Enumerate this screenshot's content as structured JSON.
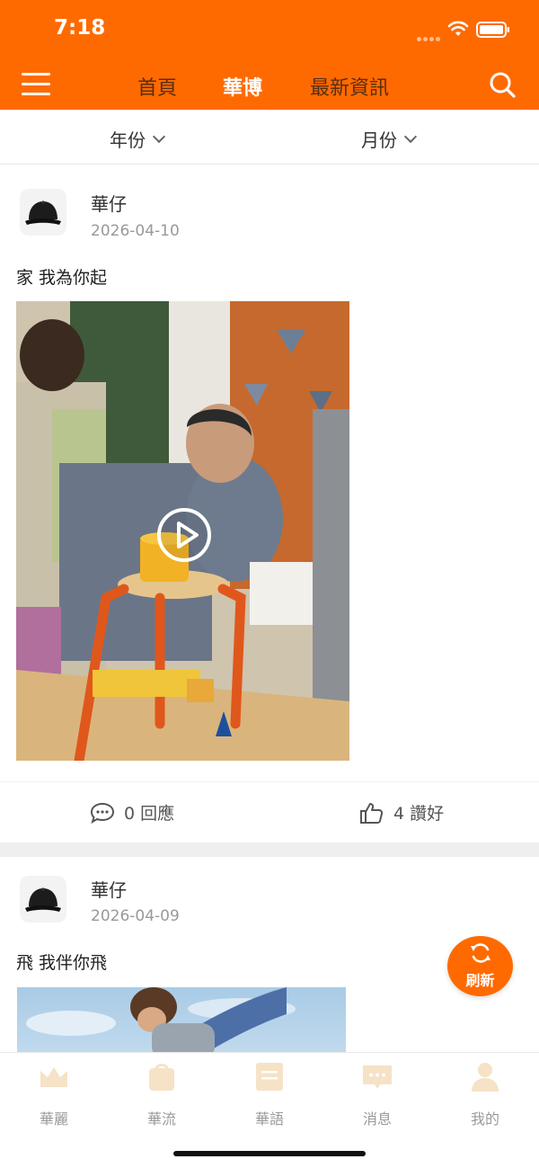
{
  "status_bar": {
    "time": "7:18"
  },
  "top_nav": {
    "tabs": [
      {
        "label": "首頁"
      },
      {
        "label": "華博"
      },
      {
        "label": "最新資訊"
      }
    ]
  },
  "filters": {
    "year": "年份",
    "month": "月份"
  },
  "posts": [
    {
      "author": "華仔",
      "date": "2026-04-10",
      "text": "家 我為你起",
      "comments_label": "0 回應",
      "likes_label": "4 讚好"
    },
    {
      "author": "華仔",
      "date": "2026-04-09",
      "text": "飛 我伴你飛"
    }
  ],
  "refresh_button": {
    "label": "刷新"
  },
  "bottom_tabs": [
    {
      "label": "華麗",
      "icon": "crown-icon"
    },
    {
      "label": "華流",
      "icon": "bag-icon"
    },
    {
      "label": "華語",
      "icon": "document-icon"
    },
    {
      "label": "消息",
      "icon": "message-icon"
    },
    {
      "label": "我的",
      "icon": "profile-icon"
    }
  ],
  "colors": {
    "brand": "#ff6a00",
    "tab_icon_inactive": "#f6e2c6"
  }
}
